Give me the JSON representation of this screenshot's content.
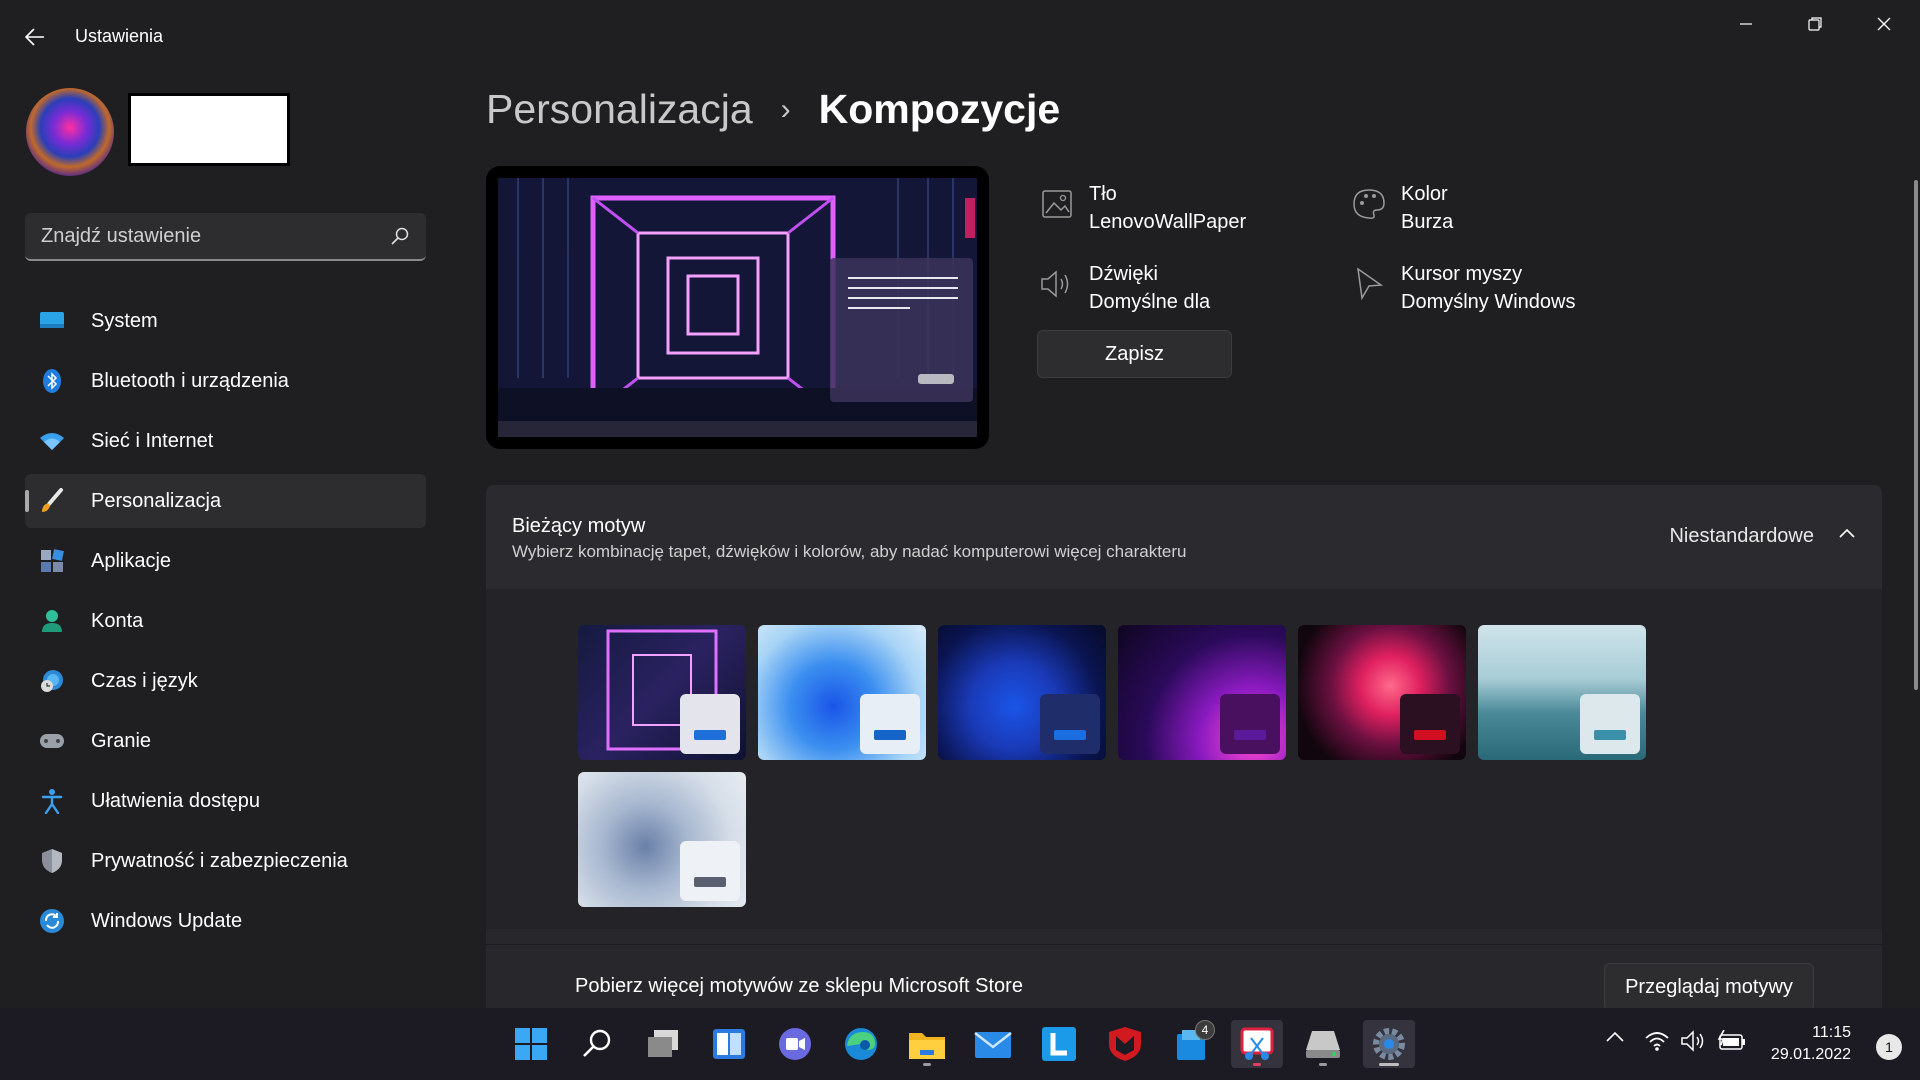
{
  "window": {
    "title": "Ustawienia"
  },
  "sidebar": {
    "search_placeholder": "Znajdź ustawienie",
    "items": [
      {
        "label": "System",
        "icon": "monitor-icon"
      },
      {
        "label": "Bluetooth i urządzenia",
        "icon": "bluetooth-icon"
      },
      {
        "label": "Sieć i Internet",
        "icon": "wifi-icon"
      },
      {
        "label": "Personalizacja",
        "icon": "brush-icon",
        "active": true
      },
      {
        "label": "Aplikacje",
        "icon": "apps-icon"
      },
      {
        "label": "Konta",
        "icon": "person-icon"
      },
      {
        "label": "Czas i język",
        "icon": "globe-clock-icon"
      },
      {
        "label": "Granie",
        "icon": "gamepad-icon"
      },
      {
        "label": "Ułatwienia dostępu",
        "icon": "accessibility-icon"
      },
      {
        "label": "Prywatność i zabezpieczenia",
        "icon": "shield-icon"
      },
      {
        "label": "Windows Update",
        "icon": "update-icon"
      }
    ]
  },
  "breadcrumb": {
    "parent": "Personalizacja",
    "separator": "›",
    "current": "Kompozycje"
  },
  "theme_details": {
    "background_label": "Tło",
    "background_value": "LenovoWallPaper",
    "color_label": "Kolor",
    "color_value": "Burza",
    "sounds_label": "Dźwięki",
    "sounds_value": "Domyślne dla",
    "cursor_label": "Kursor myszy",
    "cursor_value": "Domyślny Windows",
    "save_label": "Zapisz"
  },
  "current_theme": {
    "title": "Bieżący motyw",
    "subtitle": "Wybierz kombinację tapet, dźwięków i kolorów, aby nadać komputerowi więcej charakteru",
    "value": "Niestandardowe",
    "themes": [
      {
        "name": "custom-lenovo",
        "accent": "#1e6fd9"
      },
      {
        "name": "windows-light",
        "accent": "#1565c8"
      },
      {
        "name": "windows-dark",
        "accent": "#1a6ee0"
      },
      {
        "name": "glow",
        "accent": "#5a1a9a"
      },
      {
        "name": "captured-motion",
        "accent": "#d01020"
      },
      {
        "name": "sunrise",
        "accent": "#3a90a8"
      },
      {
        "name": "flow",
        "accent": "#5a6070"
      }
    ]
  },
  "store": {
    "text": "Pobierz więcej motywów ze sklepu Microsoft Store",
    "button_label": "Przeglądaj motywy"
  },
  "taskbar": {
    "mail_badge": "4",
    "time": "11:15",
    "date": "29.01.2022",
    "notifications": "1"
  },
  "colors": {
    "accent": "#4cc2ff",
    "window_bg": "#1f1f22",
    "panel_bg": "#28282c"
  }
}
